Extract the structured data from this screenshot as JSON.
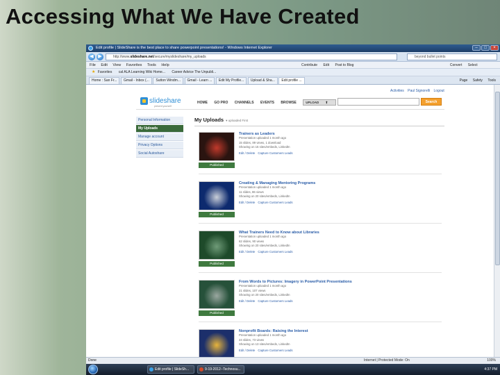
{
  "slide": {
    "title": "Accessing What We Have Created"
  },
  "browser": {
    "window_title": "Edit profile | SlideShare is the best place to share powerpoint presentations! - Windows Internet Explorer",
    "address_prefix": "http://www.",
    "address_host": "slideshare.net",
    "address_rest": "/secure/myslideshare/my_uploads",
    "search_placeholder": "beyond bullet points",
    "menu": [
      "File",
      "Edit",
      "View",
      "Favorites",
      "Tools",
      "Help"
    ],
    "toolbar_right": [
      "Contribute",
      "Edit",
      "Post to Blog",
      "Convert",
      "Select"
    ],
    "favorites": [
      "Favorites",
      "cal ALA Learning Wiki Home...",
      "Career Advice The Unpubli..."
    ],
    "tabs": [
      "Home : San Fr...",
      "Gmail - Inbox (...",
      "Sutton Windm...",
      "Gmail - Learn ...",
      "Edit My Profile...",
      "Upload & Sha...",
      "Edit profile ..."
    ],
    "tab_tools": [
      "Page",
      "Safety",
      "Tools"
    ],
    "status_left": "Done",
    "status_zone": "Internet | Protected Mode: On",
    "zoom": "100%"
  },
  "slideshare": {
    "user_links": [
      "Activities",
      "Paul Signorelli",
      "Logout"
    ],
    "logo_word": "slideshare",
    "logo_tag": "present yourself",
    "nav": [
      "HOME",
      "GO PRO",
      "CHANNELS",
      "EVENTS",
      "BROWSE"
    ],
    "upload_label": "UPLOAD",
    "search_button": "Search",
    "sidebar": [
      "Personal Information",
      "My Uploads",
      "Manage account",
      "Privacy Options",
      "Social Autoshare"
    ],
    "main_title": "My Uploads",
    "main_sub": "uploaded First",
    "published_label": "Published",
    "items": [
      {
        "title": "Trainers as Leaders",
        "meta1": "Presentation uploaded 1 month ago",
        "meta2": "15 slides, 89 views, 1 download",
        "meta3": "Showing on 15 sites/embeds, LinkedIn",
        "actions": [
          "Edit / Delete",
          "Capture Customers Leads"
        ],
        "thumb_color": "#2a1410",
        "thumb_accent": "#c0392b"
      },
      {
        "title": "Creating & Managing Mentoring Programs",
        "meta1": "Presentation uploaded 1 month ago",
        "meta2": "11 slides, 86 views",
        "meta3": "Showing on 20 sites/embeds, LinkedIn",
        "actions": [
          "Edit / Delete",
          "Capture Customers Leads"
        ],
        "thumb_color": "#0d2a6e",
        "thumb_accent": "#c9ced8"
      },
      {
        "title": "What Trainers Need to Know about Libraries",
        "meta1": "Presentation uploaded 1 month ago",
        "meta2": "62 slides, 90 views",
        "meta3": "Showing on 20 sites/embeds, LinkedIn",
        "actions": [
          "Edit / Delete",
          "Capture Customers Leads"
        ],
        "thumb_color": "#1e4a2a",
        "thumb_accent": "#6f9b78"
      },
      {
        "title": "From Words to Pictures: Imagery in PowerPoint Presentations",
        "meta1": "Presentation uploaded 1 month ago",
        "meta2": "21 slides, 107 views",
        "meta3": "Showing on 20 sites/embeds, LinkedIn",
        "actions": [
          "Edit / Delete",
          "Capture Customers Leads"
        ],
        "thumb_color": "#26513a",
        "thumb_accent": "#9aa7a0"
      },
      {
        "title": "Nonprofit Boards: Raising the Interest",
        "meta1": "Presentation uploaded 1 month ago",
        "meta2": "24 slides, 73 views",
        "meta3": "Showing on 13 sites/embeds, LinkedIn",
        "actions": [
          "Edit / Delete",
          "Capture Customers Leads"
        ],
        "thumb_color": "#1c2f6b",
        "thumb_accent": "#e7b43b"
      }
    ]
  },
  "taskbar": {
    "tasks": [
      "Edit profile | SlideSh...",
      "9-19-2012--Technosu..."
    ],
    "clock": "4:37 PM"
  }
}
